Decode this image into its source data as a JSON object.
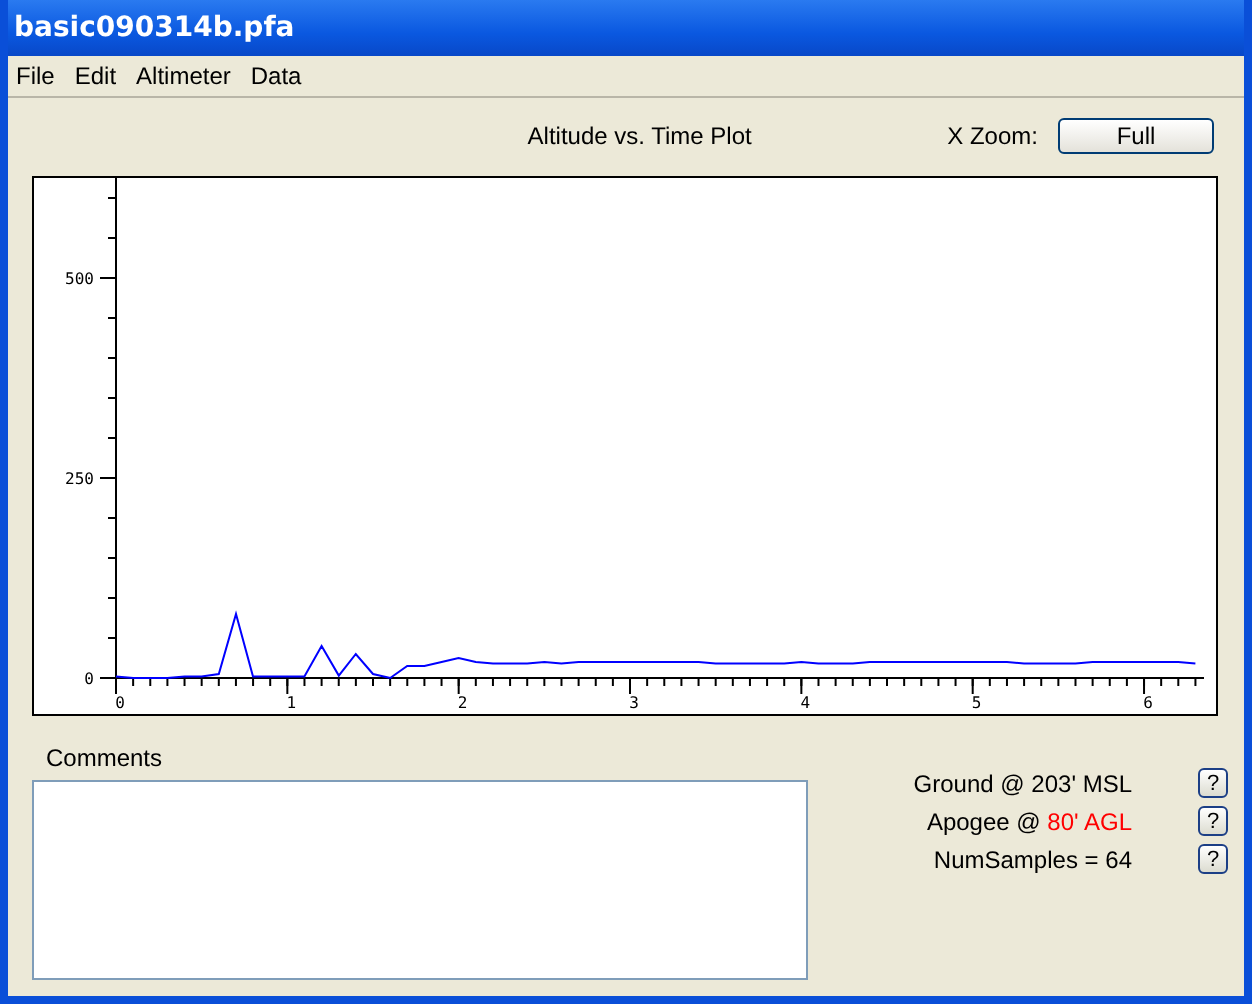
{
  "window": {
    "title": "basic090314b.pfa"
  },
  "menu": [
    "File",
    "Edit",
    "Altimeter",
    "Data"
  ],
  "plot": {
    "title": "Altitude vs. Time Plot",
    "zoom_label": "X Zoom:",
    "zoom_button": "Full",
    "chart_data": {
      "type": "line",
      "xlim": [
        0,
        6.35
      ],
      "ylim": [
        0,
        620
      ],
      "xticks": [
        0,
        1,
        2,
        3,
        4,
        5,
        6
      ],
      "yticks": [
        0,
        250,
        500
      ],
      "x": [
        0,
        0.1,
        0.2,
        0.3,
        0.4,
        0.5,
        0.6,
        0.7,
        0.8,
        0.9,
        1.0,
        1.1,
        1.2,
        1.3,
        1.4,
        1.5,
        1.6,
        1.7,
        1.8,
        1.9,
        2.0,
        2.1,
        2.2,
        2.3,
        2.4,
        2.5,
        2.6,
        2.7,
        2.8,
        2.9,
        3.0,
        3.1,
        3.2,
        3.3,
        3.4,
        3.5,
        3.6,
        3.7,
        3.8,
        3.9,
        4.0,
        4.1,
        4.2,
        4.3,
        4.4,
        4.5,
        4.6,
        4.7,
        4.8,
        4.9,
        5.0,
        5.1,
        5.2,
        5.3,
        5.4,
        5.5,
        5.6,
        5.7,
        5.8,
        5.9,
        6.0,
        6.1,
        6.2,
        6.3
      ],
      "series": [
        {
          "color": "#0000ff",
          "values": [
            2,
            0,
            0,
            0,
            2,
            2,
            5,
            80,
            2,
            2,
            2,
            2,
            40,
            3,
            30,
            5,
            0,
            15,
            15,
            20,
            25,
            20,
            18,
            18,
            18,
            20,
            18,
            20,
            20,
            20,
            20,
            20,
            20,
            20,
            20,
            18,
            18,
            18,
            18,
            18,
            20,
            18,
            18,
            18,
            20,
            20,
            20,
            20,
            20,
            20,
            20,
            20,
            20,
            18,
            18,
            18,
            18,
            20,
            20,
            20,
            20,
            20,
            20,
            18
          ]
        }
      ]
    }
  },
  "comments": {
    "label": "Comments"
  },
  "info": [
    {
      "label": "Ground @",
      "value": "203' MSL",
      "highlighted": false,
      "help": "?"
    },
    {
      "label": "Apogee @",
      "value": "80' AGL",
      "highlighted": true,
      "help": "?"
    },
    {
      "label": "NumSamples =",
      "value": "64",
      "highlighted": false,
      "help": "?"
    }
  ]
}
